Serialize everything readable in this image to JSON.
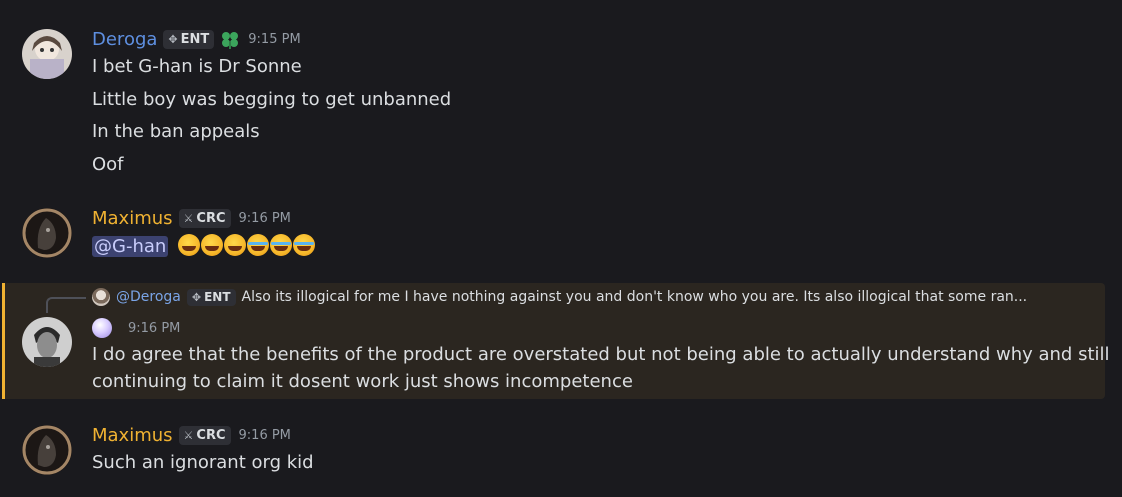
{
  "messages": [
    {
      "username": "Deroga",
      "username_color": "#5e8fe0",
      "tag": "ENT",
      "tag_icon": "diamond-dots-icon",
      "extra_icon": "clover-icon",
      "timestamp": "9:15 PM",
      "lines": [
        "I bet G-han is Dr Sonne",
        "Little boy was begging to get unbanned",
        "In the ban appeals",
        "Oof"
      ]
    },
    {
      "username": "Maximus",
      "username_color": "#f0b232",
      "tag": "CRC",
      "tag_icon": "crossed-swords-icon",
      "timestamp": "9:16 PM",
      "mention": "@G-han",
      "emojis": [
        "joy",
        "joy",
        "joy",
        "sob",
        "sob",
        "sob"
      ]
    },
    {
      "reply": {
        "name": "@Deroga",
        "tag": "ENT",
        "text": "Also its illogical for me I have nothing against you and don't know who you are. Its also illogical that some ran..."
      },
      "timestamp": "9:16 PM",
      "lines": [
        "I do agree that the benefits of the product are overstated but not being able to actually understand why and still",
        "continuing to claim it dosent work just shows incompetence"
      ],
      "highlight_color": "#f0b232"
    },
    {
      "username": "Maximus",
      "username_color": "#f0b232",
      "tag": "CRC",
      "tag_icon": "crossed-swords-icon",
      "timestamp": "9:16 PM",
      "lines": [
        "Such an ignorant org kid"
      ]
    }
  ]
}
